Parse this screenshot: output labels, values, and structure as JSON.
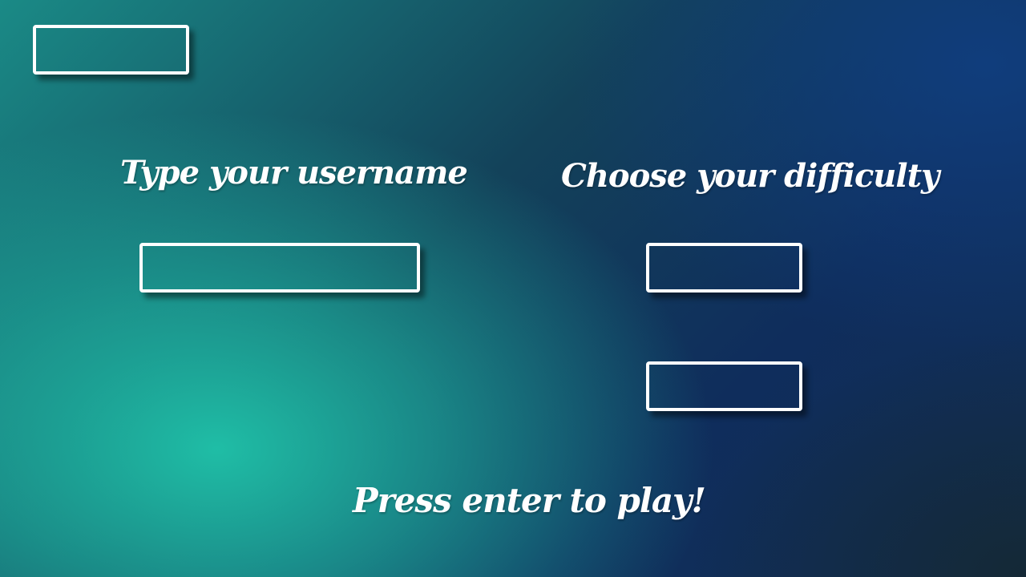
{
  "top_button": {
    "label": ""
  },
  "username": {
    "heading": "Type your username",
    "value": ""
  },
  "difficulty": {
    "heading": "Choose your difficulty",
    "options": [
      "",
      ""
    ]
  },
  "prompt": "Press enter to play!",
  "colors": {
    "text": "#ffffff",
    "border": "#ffffff",
    "bg_teal": "#20c4aa",
    "bg_navy": "#103e7e"
  }
}
